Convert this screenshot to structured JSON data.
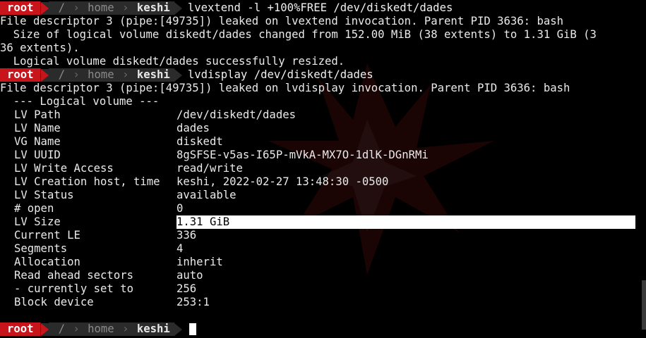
{
  "prompt": {
    "user": "root",
    "path_root": "/",
    "path_dir": "home",
    "host": "keshi"
  },
  "commands": {
    "first": "lvextend -l +100%FREE /dev/diskedt/dades",
    "second": "lvdisplay /dev/diskedt/dades"
  },
  "output1": [
    "File descriptor 3 (pipe:[49735]) leaked on lvextend invocation. Parent PID 3636: bash",
    "  Size of logical volume diskedt/dades changed from 152.00 MiB (38 extents) to 1.31 GiB (3",
    "36 extents).",
    "  Logical volume diskedt/dades successfully resized."
  ],
  "output2_header": [
    "File descriptor 3 (pipe:[49735]) leaked on lvdisplay invocation. Parent PID 3636: bash",
    "  --- Logical volume ---"
  ],
  "lv_fields": [
    {
      "key": "LV Path",
      "value": "/dev/diskedt/dades"
    },
    {
      "key": "LV Name",
      "value": "dades"
    },
    {
      "key": "VG Name",
      "value": "diskedt"
    },
    {
      "key": "LV UUID",
      "value": "8gSFSE-v5as-I65P-mVkA-MX7O-1dlK-DGnRMi"
    },
    {
      "key": "LV Write Access",
      "value": "read/write"
    },
    {
      "key": "LV Creation host, time",
      "value": "keshi, 2022-02-27 13:48:30 -0500"
    },
    {
      "key": "LV Status",
      "value": "available"
    },
    {
      "key": "# open",
      "value": "0"
    },
    {
      "key": "LV Size",
      "value": "1.31 GiB"
    },
    {
      "key": "Current LE",
      "value": "336"
    },
    {
      "key": "Segments",
      "value": "4"
    },
    {
      "key": "Allocation",
      "value": "inherit"
    },
    {
      "key": "Read ahead sectors",
      "value": "auto"
    },
    {
      "key": "- currently set to",
      "value": "256"
    },
    {
      "key": "Block device",
      "value": "253:1"
    }
  ],
  "highlighted_field": "LV Size",
  "colors": {
    "prompt_root_bg": "#c8151b",
    "prompt_segment_bg": "#2b2b2b",
    "background": "#000000",
    "text": "#eaeaea",
    "selection_bg": "#ffffff"
  }
}
